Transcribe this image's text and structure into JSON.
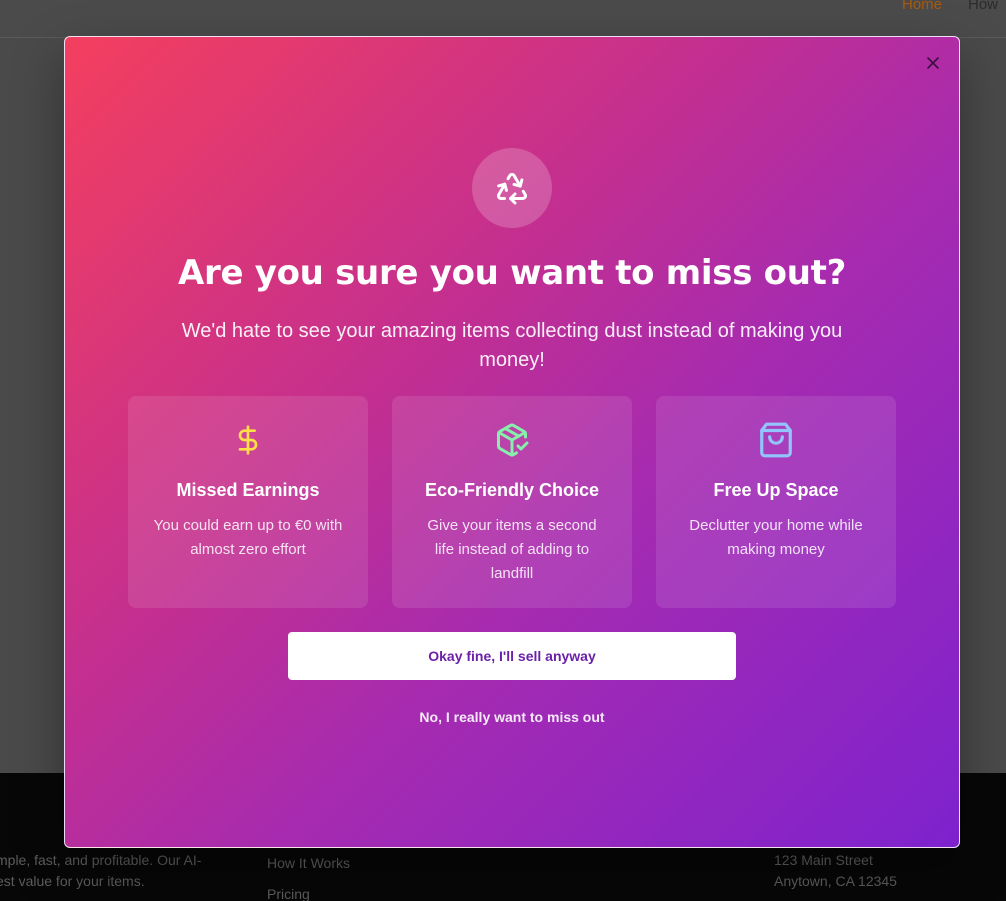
{
  "nav": {
    "items": [
      "Home",
      "How"
    ]
  },
  "footer": {
    "about": "mple, fast, and profitable. Our AI- est value for your items.",
    "links": [
      "How It Works",
      "Pricing"
    ],
    "address": [
      "123 Main Street",
      "Anytown, CA 12345"
    ]
  },
  "modal": {
    "close_icon": "close-icon",
    "hero_icon": "recycle-icon",
    "title": "Are you sure you want to miss out?",
    "subtitle": "We'd hate to see your amazing items collecting dust instead of making you money!",
    "cards": [
      {
        "icon": "dollar-icon",
        "icon_color": "#fde047",
        "title": "Missed Earnings",
        "text": "You could earn up to €0 with almost zero effort"
      },
      {
        "icon": "package-check-icon",
        "icon_color": "#86efac",
        "title": "Eco-Friendly Choice",
        "text": "Give your items a second life instead of adding to landfill"
      },
      {
        "icon": "shopping-bag-icon",
        "icon_color": "#93c5fd",
        "title": "Free Up Space",
        "text": "Declutter your home while making money"
      }
    ],
    "primary_label": "Okay fine, I'll sell anyway",
    "secondary_label": "No, I really want to miss out"
  },
  "colors": {
    "gradient_start": "#f43f5e",
    "gradient_end": "#7e22ce",
    "primary_button_text": "#6b21a8"
  }
}
